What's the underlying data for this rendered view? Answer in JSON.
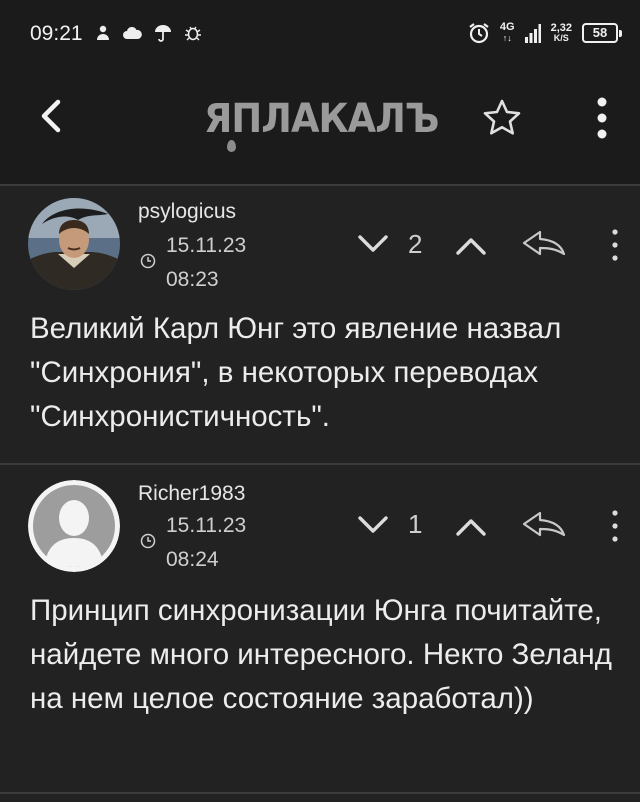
{
  "status_bar": {
    "time": "09:21",
    "network_top": "4G",
    "network_bottom": "↑↓",
    "speed_value": "2,32",
    "speed_unit": "K/S",
    "battery": "58",
    "icons": [
      "person-icon",
      "cloud-icon",
      "umbrella-icon",
      "bug-icon",
      "alarm-icon",
      "signal-icon"
    ]
  },
  "header": {
    "logo": "ЯПЛАКАЛЪ",
    "icons": [
      "back-arrow-icon",
      "star-icon",
      "more-vertical-icon"
    ]
  },
  "comments": [
    {
      "username": "psylogicus",
      "date": "15.11.23",
      "time": "08:23",
      "votes": "2",
      "text": "Великий Карл Юнг это явление назвал \"Синхрония\", в некоторых переводах \"Синхронистичность\"."
    },
    {
      "username": "Richer1983",
      "date": "15.11.23",
      "time": "08:24",
      "votes": "1",
      "text": "Принцип синхронизации Юнга почитайте, найдете много интересного. Некто Зеланд на нем целое состояние заработал))"
    }
  ],
  "colors": {
    "background": "#222222",
    "bars": "#1b1b1b",
    "divider": "#3b3b3b",
    "text": "#ececec",
    "logo": "#9a9a9a"
  }
}
